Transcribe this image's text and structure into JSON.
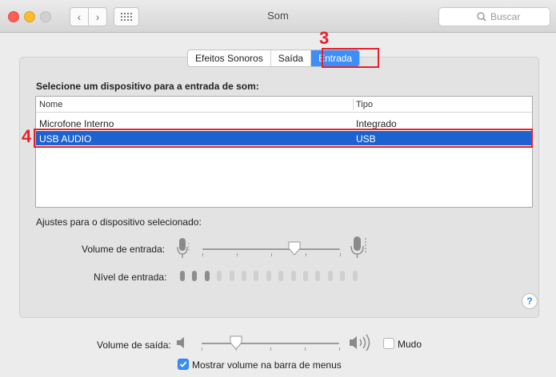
{
  "window": {
    "title": "Som"
  },
  "toolbar": {
    "back_glyph": "‹",
    "forward_glyph": "›",
    "search_placeholder": "Buscar"
  },
  "tabs": [
    {
      "label": "Efeitos Sonoros",
      "selected": false
    },
    {
      "label": "Saída",
      "selected": false
    },
    {
      "label": "Entrada",
      "selected": true
    }
  ],
  "annotations": {
    "step3": "3",
    "step4": "4",
    "color": "#e8212a"
  },
  "input": {
    "heading": "Selecione um dispositivo para a entrada de som:",
    "columns": [
      "Nome",
      "Tipo"
    ],
    "devices": [
      {
        "name": "Microfone Interno",
        "type": "Integrado",
        "selected": false
      },
      {
        "name": "USB AUDIO",
        "type": "USB",
        "selected": true
      }
    ],
    "settings_heading": "Ajustes para o dispositivo selecionado:",
    "volume_label": "Volume de entrada:",
    "volume_fraction": 0.67,
    "level_label": "Nível de entrada:",
    "level_segments_total": 15,
    "level_segments_active": 3
  },
  "output": {
    "volume_label": "Volume de saída:",
    "volume_fraction": 0.25,
    "mute_label": "Mudo",
    "mute_checked": false,
    "show_in_menubar_label": "Mostrar volume na barra de menus",
    "show_in_menubar_checked": true
  },
  "help": {
    "glyph": "?"
  },
  "colors": {
    "accent": "#3d8ef7",
    "selection": "#1c63d1",
    "annotation": "#e8212a"
  }
}
